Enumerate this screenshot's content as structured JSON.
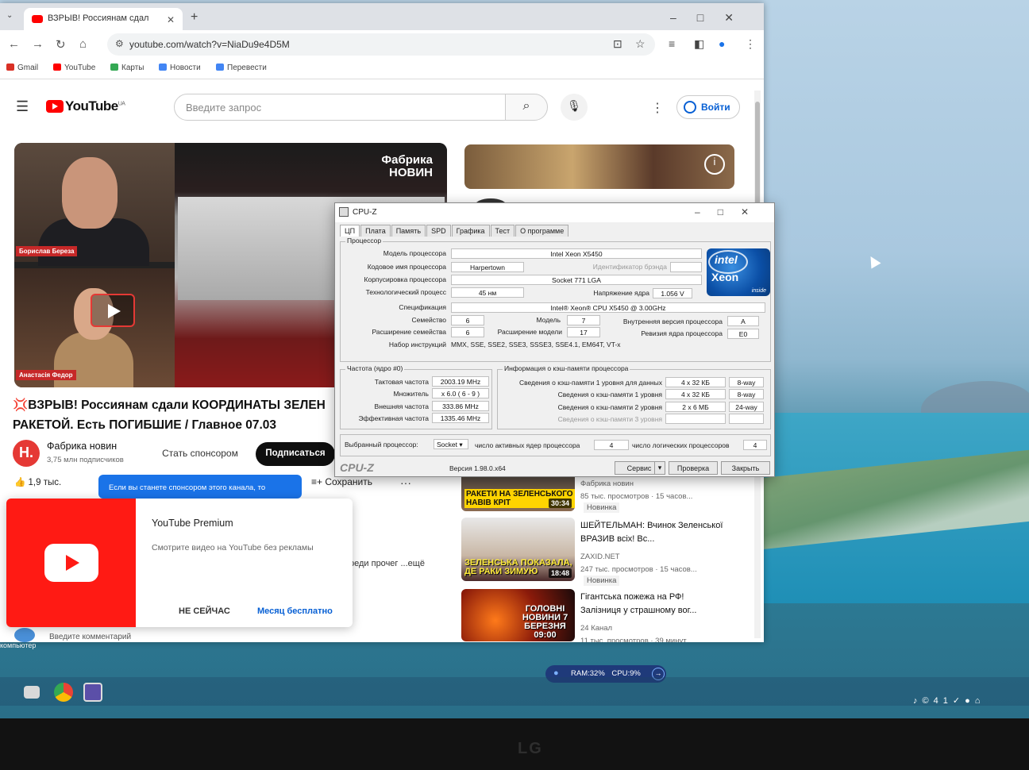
{
  "browser": {
    "tab_title": "ВЗРЫВ! Россиянам сдал",
    "url": "youtube.com/watch?v=NiaDu9e4D5M",
    "bookmarks": [
      "Gmail",
      "YouTube",
      "Карты",
      "Новости",
      "Перевести"
    ],
    "bookmark_colors": [
      "#d93025",
      "#ff0000",
      "#34a853",
      "#4285f4",
      "#4285f4"
    ]
  },
  "youtube": {
    "logo": "YouTube",
    "logo_region": "UA",
    "search_placeholder": "Введите запрос",
    "signin": "Войти",
    "player": {
      "brand_line1": "Фабрика",
      "brand_line2": "НОВИН",
      "host1": "Борислав Береза",
      "host2": "Анастасія Федор"
    },
    "video_title": "💢ВЗРЫВ! Россиянам сдали КООРДИНАТЫ ЗЕЛЕН РАКЕТОЙ. Есть ПОГИБШИЕ / Главное 07.03",
    "channel_initial": "Н.",
    "channel_name": "Фабрика новин",
    "channel_subs": "3,75 млн подписчиков",
    "sponsor": "Стать спонсором",
    "subscribe": "Подписаться",
    "likes": "1,9 тыс.",
    "save": "Сохранить",
    "tooltip": "Если вы станете спонсором этого канала, то",
    "desc_more": "реди прочег ...ещё",
    "comment_placeholder": "Введите комментарий",
    "premium": {
      "title": "YouTube Premium",
      "text": "Смотрите видео на YouTube без рекламы",
      "later": "НЕ СЕЙЧАС",
      "trial": "Месяц бесплатно"
    },
    "recommendations": [
      {
        "caption": "РАКЕТИ НА ЗЕЛЕНСЬКОГО НАВІВ КРІТ",
        "duration": "30:34",
        "title": "",
        "channel": "Фабрика новин",
        "meta": "85 тыс. просмотров · 15 часов...",
        "badge": "Новинка"
      },
      {
        "caption": "ЗЕЛЕНСЬКА ПОКАЗАЛА, ДЕ РАКИ ЗИМУЮ",
        "duration": "18:48",
        "title": "ШЕЙТЕЛЬМАН: Вчинок Зеленської ВРАЗИВ всіх! Вс...",
        "channel": "ZAXID.NET",
        "meta": "247 тыс. просмотров · 15 часов...",
        "badge": "Новинка"
      },
      {
        "caption": "ГОЛОВНІ НОВИНИ 7 БЕРЕЗНЯ 09:00",
        "duration": "",
        "title": "Гігантська пожежа на РФ! Залізниця у страшному вог...",
        "channel": "24 Канал",
        "meta": "11 тыс. просмотров · 39 минут...",
        "badge": ""
      }
    ]
  },
  "cpuz": {
    "title": "CPU-Z",
    "tabs": [
      "ЦП",
      "Плата",
      "Память",
      "SPD",
      "Графика",
      "Тест",
      "О программе"
    ],
    "processor_group": "Процессор",
    "fields": {
      "model_label": "Модель процессора",
      "model": "Intel Xeon X5450",
      "codename_label": "Кодовое имя процессора",
      "codename": "Harpertown",
      "brand_id_label": "Идентификатор брэнда",
      "package_label": "Корпусировка процессора",
      "package": "Socket 771 LGA",
      "tech_label": "Технологический процесс",
      "tech": "45 нм",
      "voltage_label": "Напряжение ядра",
      "voltage": "1.056 V",
      "spec_label": "Спецификация",
      "spec": "Intel® Xeon® CPU          X5450  @ 3.00GHz",
      "family_label": "Семейство",
      "family": "6",
      "model_num_label": "Модель",
      "model_num": "7",
      "stepping_label": "Внутренняя версия процессора",
      "stepping": "A",
      "ext_family_label": "Расширение семейства",
      "ext_family": "6",
      "ext_model_label": "Расширение модели",
      "ext_model": "17",
      "revision_label": "Ревизия ядра процессора",
      "revision": "E0",
      "instructions_label": "Набор инструкций",
      "instructions": "MMX, SSE, SSE2, SSE3, SSSE3, SSE4.1, EM64T, VT-x"
    },
    "clocks": {
      "group": "Частота (ядро #0)",
      "core_speed_label": "Тактовая частота",
      "core_speed": "2003.19 MHz",
      "multiplier_label": "Множитель",
      "multiplier": "x 6.0 ( 6 - 9 )",
      "bus_label": "Внешняя частота",
      "bus": "333.86 MHz",
      "fsb_label": "Эффективная частота",
      "fsb": "1335.46 MHz"
    },
    "cache": {
      "group": "Информация о кэш-памяти процессора",
      "l1d_label": "Сведения о кэш-памяти 1 уровня для данных",
      "l1d": "4 x 32 КБ",
      "l1d_way": "8-way",
      "l1i_label": "Сведения о кэш-памяти 1 уровня",
      "l1i": "4 x 32 КБ",
      "l1i_way": "8-way",
      "l2_label": "Сведения о кэш-памяти 2 уровня",
      "l2": "2 x 6 МБ",
      "l2_way": "24-way",
      "l3_label": "Сведения о кэш-памяти 3 уровня"
    },
    "selection": {
      "label": "Выбранный процессор:",
      "value": "Socket",
      "cores_label": "число активных ядер процессора",
      "cores": "4",
      "threads_label": "число логических процессоров",
      "threads": "4"
    },
    "footer": {
      "brand": "CPU-Z",
      "version": "Версия 1.98.0.x64",
      "tools": "Сервис",
      "validate": "Проверка",
      "close": "Закрыть"
    },
    "logo": {
      "intel": "intel",
      "xeon": "Xeon",
      "inside": "inside"
    }
  },
  "widget": {
    "ram": "RAM:32%",
    "cpu": "CPU:9%"
  },
  "desktop_label": "Этот компьютер",
  "tray_number": "41",
  "monitor_brand": "LG"
}
